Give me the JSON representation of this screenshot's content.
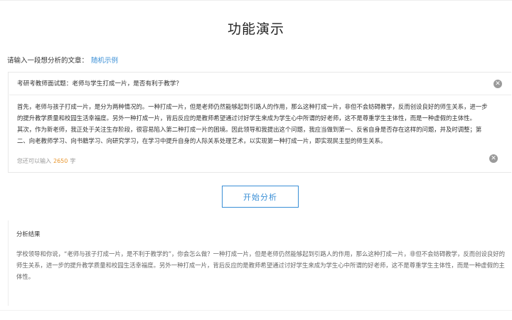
{
  "page": {
    "title": "功能演示"
  },
  "input_section": {
    "prompt_label": "请输入一段想分析的文章：",
    "example_link": "随机示例"
  },
  "essay": {
    "title": "考研考教师面试题：老师与学生打成一片，是否有利于教学？",
    "paragraphs": [
      "首先，老师与孩子打成一片，是分为两种情况的。一种打成一片，但是老师仍然能够起到引路人的作用，那么这种打成一片，非但不会妨碍教学，反而创设良好的师生关系，进一步的提升教学质量和校园生活幸福度。另外一种打成一片，背后反应的是教师希望通过讨好学生来成为学生心中所谓的好老师，这不是尊重学生主体性，而是一种虚假的主体性。",
      "其次，作为新老师，我正处于关注生存阶段，很容易陷入第二种打成一片的困境。因此领导和我提出这个问题，我应当做到第一、反省自身是否存在这样的问题，并及时调整；第二、向老教师学习、向书籍学习、向研究学习，在学习中提升自身的人际关系处理艺术，以实现第一种打成一片，即实现民主型的师生关系。"
    ],
    "counter_prefix": "您还可以输入",
    "counter_value": "2650",
    "counter_suffix": "字"
  },
  "actions": {
    "analyze_label": "开始分析"
  },
  "result": {
    "title": "分析结果",
    "text": "学校领导和你说，“老师与孩子打成一片，是不利于教学的”，你会怎么做？一种打成一片，但是老师仍然能够起到引路人的作用，那么这种打成一片，非但不会妨碍教学，反而创设良好的师生关系，进一步的提升教学质量和校园生活幸福度。另外一种打成一片，背后反应的是教师希望通过讨好学生来成为学生心中所谓的好老师，这不是尊重学生主体性，而是一种虚假的主体性。"
  }
}
